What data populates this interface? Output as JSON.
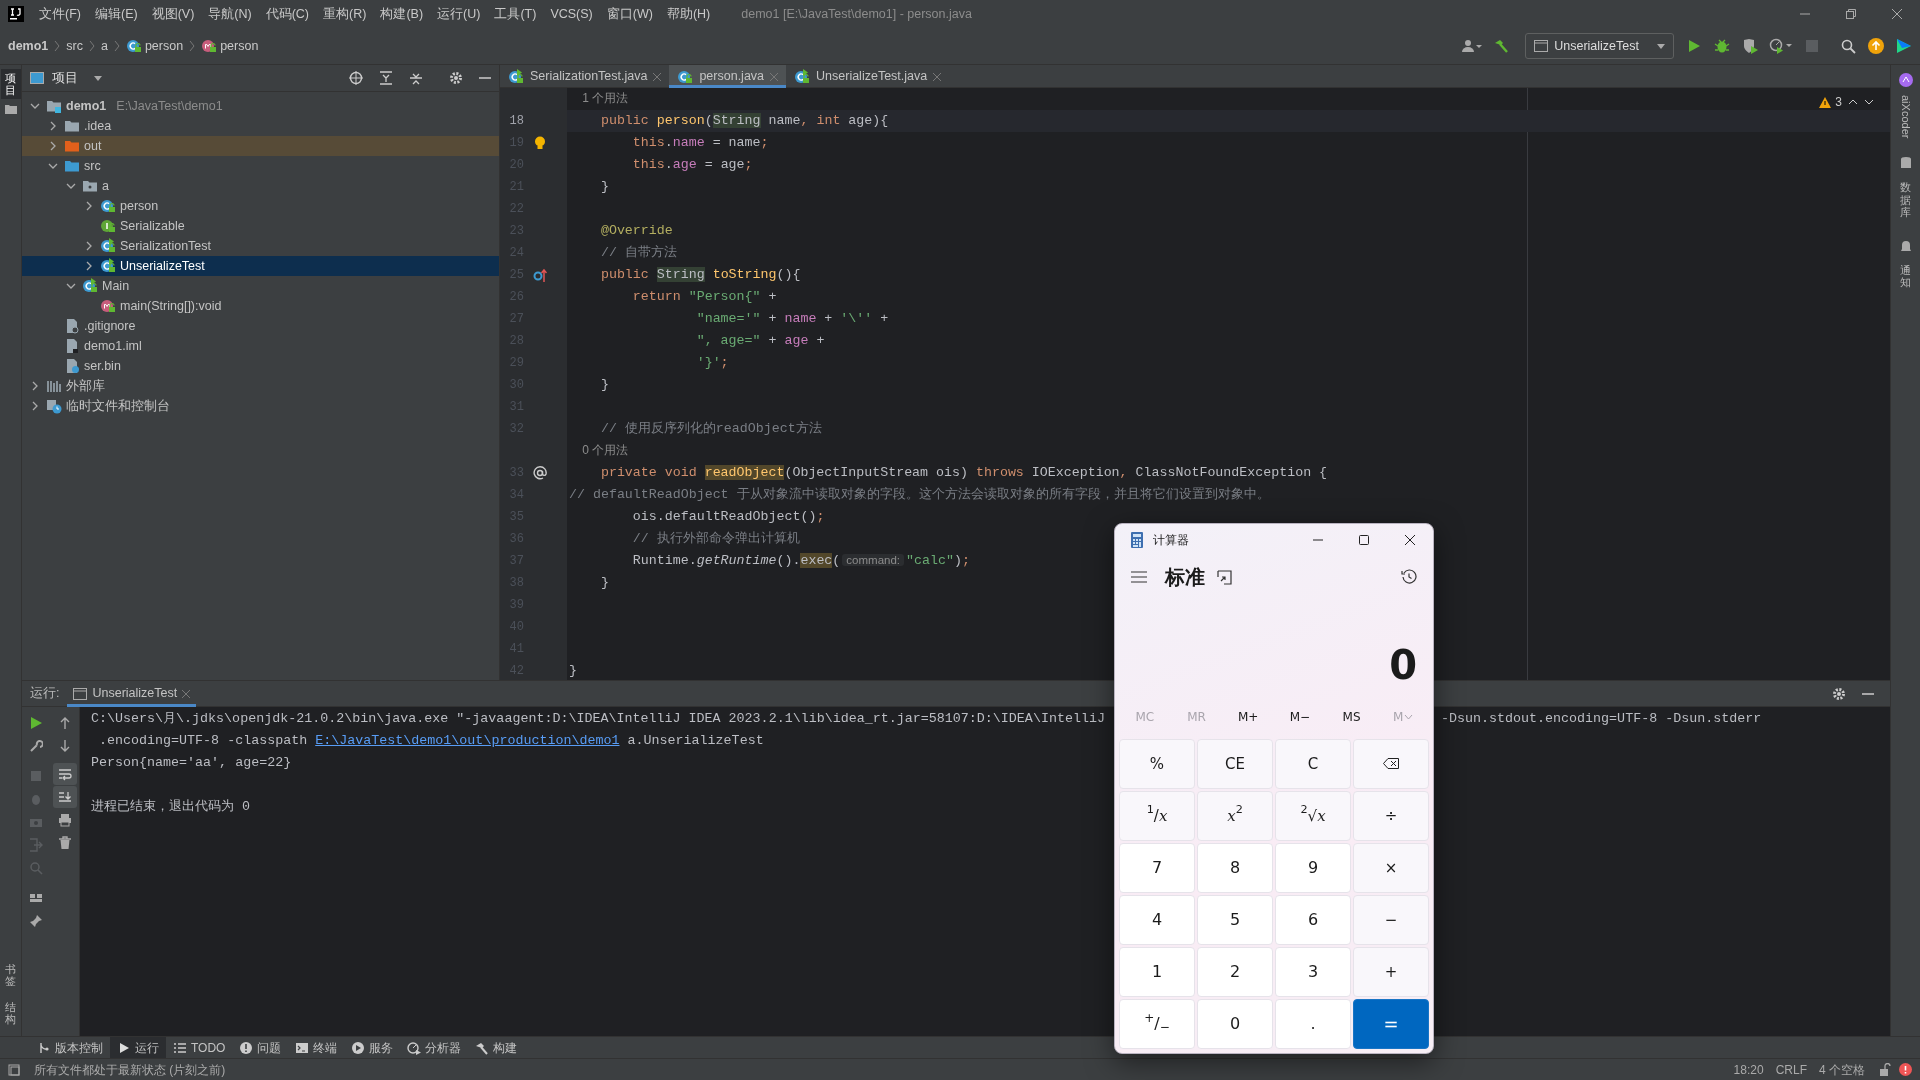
{
  "window": {
    "title": "demo1 [E:\\JavaTest\\demo1] - person.java"
  },
  "menu": [
    "文件(F)",
    "编辑(E)",
    "视图(V)",
    "导航(N)",
    "代码(C)",
    "重构(R)",
    "构建(B)",
    "运行(U)",
    "工具(T)",
    "VCS(S)",
    "窗口(W)",
    "帮助(H)"
  ],
  "breadcrumb": [
    {
      "label": "demo1",
      "kind": "project"
    },
    {
      "label": "src",
      "kind": "plain"
    },
    {
      "label": "a",
      "kind": "plain"
    },
    {
      "label": "person",
      "kind": "class"
    },
    {
      "label": "person",
      "kind": "method"
    }
  ],
  "run_config": "UnserializeTest",
  "left_strip": [
    {
      "label": "项目",
      "selected": true
    },
    {
      "label": "书签",
      "selected": false
    },
    {
      "label": "结构",
      "selected": false
    }
  ],
  "right_strip": [
    "aiXcoder",
    "数据库",
    "通知"
  ],
  "project": {
    "title": "项目",
    "tree": [
      {
        "label": "demo1",
        "path": "E:\\JavaTest\\demo1",
        "kind": "module",
        "expanded": true,
        "selected": false,
        "children": [
          {
            "label": ".idea",
            "kind": "folder",
            "expanded": false,
            "selected": false
          },
          {
            "label": "out",
            "kind": "excluded-folder",
            "expanded": false,
            "selected": false
          },
          {
            "label": "src",
            "kind": "source-folder",
            "expanded": true,
            "selected": false,
            "children": [
              {
                "label": "a",
                "kind": "package",
                "expanded": true,
                "selected": false,
                "children": [
                  {
                    "label": "person",
                    "kind": "class",
                    "expanded": false,
                    "selected": false
                  },
                  {
                    "label": "Serializable",
                    "kind": "interface",
                    "selected": false
                  },
                  {
                    "label": "SerializationTest",
                    "kind": "runnable-class",
                    "expanded": false,
                    "selected": false
                  },
                  {
                    "label": "UnserializeTest",
                    "kind": "runnable-class",
                    "expanded": false,
                    "selected": true
                  }
                ]
              },
              {
                "label": "Main",
                "kind": "runnable-class",
                "expanded": true,
                "selected": false,
                "children": [
                  {
                    "label": "main(String[]):void",
                    "kind": "method",
                    "selected": false
                  }
                ]
              }
            ]
          },
          {
            "label": ".gitignore",
            "kind": "ignore-file",
            "selected": false
          },
          {
            "label": "demo1.iml",
            "kind": "iml-file",
            "selected": false
          },
          {
            "label": "ser.bin",
            "kind": "unknown-file",
            "selected": false
          }
        ]
      },
      {
        "label": "外部库",
        "kind": "library",
        "expanded": false,
        "selected": false
      },
      {
        "label": "临时文件和控制台",
        "kind": "scratch",
        "expanded": false,
        "selected": false
      }
    ]
  },
  "tabs": [
    {
      "label": "SerializationTest.java",
      "kind": "runnable-class",
      "selected": false
    },
    {
      "label": "person.java",
      "kind": "class",
      "selected": true
    },
    {
      "label": "UnserializeTest.java",
      "kind": "runnable-class",
      "selected": false
    }
  ],
  "editor": {
    "warnings": "3",
    "lines": [
      {
        "kind": "hint",
        "tokens": [
          {
            "text": "    1 个用法",
            "kind": "hint"
          }
        ]
      },
      {
        "kind": "code",
        "number": "18",
        "current": true,
        "tokens": [
          {
            "text": "    public ",
            "kind": "kw"
          },
          {
            "text": "person",
            "kind": "decl"
          },
          {
            "text": "(",
            "kind": "plain"
          },
          {
            "text": "String",
            "kind": "type-hl"
          },
          {
            "text": " name",
            "kind": "plain"
          },
          {
            "text": ", ",
            "kind": "kw"
          },
          {
            "text": "int ",
            "kind": "kw"
          },
          {
            "text": "age){",
            "kind": "plain"
          }
        ]
      },
      {
        "kind": "code",
        "number": "19",
        "current": false,
        "gutter": {
          "kind": "bulb"
        },
        "tokens": [
          {
            "text": "        this",
            "kind": "kw"
          },
          {
            "text": ".",
            "kind": "plain"
          },
          {
            "text": "name",
            "kind": "field"
          },
          {
            "text": " = name",
            "kind": "plain"
          },
          {
            "text": ";",
            "kind": "kw"
          }
        ]
      },
      {
        "kind": "code",
        "number": "20",
        "current": false,
        "tokens": [
          {
            "text": "        this",
            "kind": "kw"
          },
          {
            "text": ".",
            "kind": "plain"
          },
          {
            "text": "age",
            "kind": "field"
          },
          {
            "text": " = age",
            "kind": "plain"
          },
          {
            "text": ";",
            "kind": "kw"
          }
        ]
      },
      {
        "kind": "code",
        "number": "21",
        "current": false,
        "tokens": [
          {
            "text": "    }",
            "kind": "plain"
          }
        ]
      },
      {
        "kind": "code",
        "number": "22",
        "current": false
      },
      {
        "kind": "code",
        "number": "23",
        "current": false,
        "tokens": [
          {
            "text": "    @Override",
            "kind": "ann"
          }
        ]
      },
      {
        "kind": "code",
        "number": "24",
        "current": false,
        "tokens": [
          {
            "text": "    // 自带方法",
            "kind": "cmt"
          }
        ]
      },
      {
        "kind": "code",
        "number": "25",
        "current": false,
        "gutter": {
          "kind": "override"
        },
        "tokens": [
          {
            "text": "    public ",
            "kind": "kw"
          },
          {
            "text": "String",
            "kind": "type-hl"
          },
          {
            "text": " toString",
            "kind": "decl"
          },
          {
            "text": "(){",
            "kind": "plain"
          }
        ]
      },
      {
        "kind": "code",
        "number": "26",
        "current": false,
        "tokens": [
          {
            "text": "        return ",
            "kind": "kw"
          },
          {
            "text": "\"Person{\"",
            "kind": "str"
          },
          {
            "text": " +",
            "kind": "plain"
          }
        ]
      },
      {
        "kind": "code",
        "number": "27",
        "current": false,
        "tokens": [
          {
            "text": "                \"name='\"",
            "kind": "str"
          },
          {
            "text": " + ",
            "kind": "plain"
          },
          {
            "text": "name",
            "kind": "field"
          },
          {
            "text": " + ",
            "kind": "plain"
          },
          {
            "text": "'\\''",
            "kind": "str"
          },
          {
            "text": " +",
            "kind": "plain"
          }
        ]
      },
      {
        "kind": "code",
        "number": "28",
        "current": false,
        "tokens": [
          {
            "text": "                \", age=\"",
            "kind": "str"
          },
          {
            "text": " + ",
            "kind": "plain"
          },
          {
            "text": "age",
            "kind": "field"
          },
          {
            "text": " +",
            "kind": "plain"
          }
        ]
      },
      {
        "kind": "code",
        "number": "29",
        "current": false,
        "tokens": [
          {
            "text": "                '}'",
            "kind": "str"
          },
          {
            "text": ";",
            "kind": "kw"
          }
        ]
      },
      {
        "kind": "code",
        "number": "30",
        "current": false,
        "tokens": [
          {
            "text": "    }",
            "kind": "plain"
          }
        ]
      },
      {
        "kind": "code",
        "number": "31",
        "current": false
      },
      {
        "kind": "code",
        "number": "32",
        "current": false,
        "tokens": [
          {
            "text": "    // 使用反序列化的readObject方法",
            "kind": "cmt"
          }
        ]
      },
      {
        "kind": "hint",
        "tokens": [
          {
            "text": "    0 个用法",
            "kind": "hint"
          }
        ]
      },
      {
        "kind": "code",
        "number": "33",
        "current": false,
        "gutter": {
          "kind": "at"
        },
        "tokens": [
          {
            "text": "    private void ",
            "kind": "kw"
          },
          {
            "text": "readObject",
            "kind": "decl-hl"
          },
          {
            "text": "(ObjectInputStream ois) ",
            "kind": "plain"
          },
          {
            "text": "throws ",
            "kind": "kw"
          },
          {
            "text": "IOException",
            "kind": "plain"
          },
          {
            "text": ", ",
            "kind": "kw"
          },
          {
            "text": "ClassNotFoundException {",
            "kind": "plain"
          }
        ]
      },
      {
        "kind": "code",
        "number": "34",
        "current": false,
        "tokens": [
          {
            "text": "// defaultReadObject 于从对象流中读取对象的字段。这个方法会读取对象的所有字段，并且将它们设置到对象中。",
            "kind": "cmt"
          }
        ]
      },
      {
        "kind": "code",
        "number": "35",
        "current": false,
        "tokens": [
          {
            "text": "        ois.defaultReadObject()",
            "kind": "plain"
          },
          {
            "text": ";",
            "kind": "kw"
          }
        ]
      },
      {
        "kind": "code",
        "number": "36",
        "current": false,
        "tokens": [
          {
            "text": "        // 执行外部命令弹出计算机",
            "kind": "cmt"
          }
        ]
      },
      {
        "kind": "code",
        "number": "37",
        "current": false,
        "tokens": [
          {
            "text": "        Runtime.",
            "kind": "plain"
          },
          {
            "text": "getRuntime",
            "kind": "static"
          },
          {
            "text": "().",
            "kind": "plain"
          },
          {
            "text": "exec",
            "kind": "call-hl"
          },
          {
            "text": "(",
            "kind": "plain"
          },
          {
            "text": "command:",
            "kind": "inlay"
          },
          {
            "text": "\"calc\"",
            "kind": "str"
          },
          {
            "text": ")",
            "kind": "plain"
          },
          {
            "text": ";",
            "kind": "kw"
          }
        ]
      },
      {
        "kind": "code",
        "number": "38",
        "current": false,
        "tokens": [
          {
            "text": "    }",
            "kind": "plain"
          }
        ]
      },
      {
        "kind": "code",
        "number": "39",
        "current": false
      },
      {
        "kind": "code",
        "number": "40",
        "current": false
      },
      {
        "kind": "code",
        "number": "41",
        "current": false
      },
      {
        "kind": "code",
        "number": "42",
        "current": false,
        "tokens": [
          {
            "text": "}",
            "kind": "plain"
          }
        ]
      }
    ]
  },
  "run": {
    "label": "运行:",
    "tab": "UnserializeTest",
    "console": [
      {
        "kind": "split",
        "parts": [
          "C:\\Users\\月\\.jdks\\openjdk-21.0.2\\bin\\java.exe \"-javaagent:D:\\IDEA\\IntelliJ IDEA 2023.2.1\\lib\\idea_rt.jar=58107:D:\\IDEA\\IntelliJ",
          "-Dsun.stdout.encoding=UTF-8 -Dsun.stderr"
        ]
      },
      {
        "kind": "link",
        "parts": [
          " .encoding=UTF-8 -classpath ",
          "E:\\JavaTest\\demo1\\out\\production\\demo1",
          " a.UnserializeTest"
        ]
      },
      {
        "kind": "plain",
        "parts": [
          "Person{name='aa', age=22}"
        ]
      },
      {
        "kind": "blank"
      },
      {
        "kind": "plain",
        "parts": [
          "进程已结束，退出代码为 0"
        ]
      }
    ]
  },
  "tool_windows": [
    {
      "label": "版本控制",
      "kind": "vcs",
      "selected": false
    },
    {
      "label": "运行",
      "kind": "run",
      "selected": true
    },
    {
      "label": "TODO",
      "kind": "todo",
      "selected": false
    },
    {
      "label": "问题",
      "kind": "problems",
      "selected": false
    },
    {
      "label": "终端",
      "kind": "terminal",
      "selected": false
    },
    {
      "label": "服务",
      "kind": "services",
      "selected": false
    },
    {
      "label": "分析器",
      "kind": "profiler",
      "selected": false
    },
    {
      "label": "构建",
      "kind": "build",
      "selected": false
    }
  ],
  "status_bar": {
    "message": "所有文件都处于最新状态 (片刻之前)",
    "position": "18:20",
    "line_separator": "CRLF",
    "indent": "4 个空格"
  },
  "calculator": {
    "title": "计算器",
    "mode": "标准",
    "display": "0",
    "memory": [
      {
        "label": "MC",
        "kind": "plain",
        "disabled": true
      },
      {
        "label": "MR",
        "kind": "plain",
        "disabled": true
      },
      {
        "label": "M+",
        "kind": "plain",
        "disabled": false
      },
      {
        "label": "M−",
        "kind": "plain",
        "disabled": false
      },
      {
        "label": "MS",
        "kind": "plain",
        "disabled": false
      },
      {
        "label": "M",
        "kind": "dropdown",
        "disabled": true
      }
    ],
    "keys": [
      {
        "label": "%",
        "kind": "op"
      },
      {
        "label": "CE",
        "kind": "op"
      },
      {
        "label": "C",
        "kind": "op"
      },
      {
        "kind": "backspace"
      },
      {
        "label": "$^{1}$/*x*",
        "kind": "op"
      },
      {
        "label": "*x*$^{2}$",
        "kind": "op"
      },
      {
        "label": "$^{2}$√*x*",
        "kind": "op"
      },
      {
        "label": "÷",
        "kind": "op"
      },
      {
        "label": "7",
        "kind": "num"
      },
      {
        "label": "8",
        "kind": "num"
      },
      {
        "label": "9",
        "kind": "num"
      },
      {
        "label": "×",
        "kind": "op"
      },
      {
        "label": "4",
        "kind": "num"
      },
      {
        "label": "5",
        "kind": "num"
      },
      {
        "label": "6",
        "kind": "num"
      },
      {
        "label": "−",
        "kind": "op"
      },
      {
        "label": "1",
        "kind": "num"
      },
      {
        "label": "2",
        "kind": "num"
      },
      {
        "label": "3",
        "kind": "num"
      },
      {
        "label": "+",
        "kind": "op"
      },
      {
        "label": "$^{+}$/$_{−}$",
        "kind": "num"
      },
      {
        "label": "0",
        "kind": "num"
      },
      {
        "label": ".",
        "kind": "num"
      },
      {
        "label": "=",
        "kind": "equals"
      }
    ]
  }
}
